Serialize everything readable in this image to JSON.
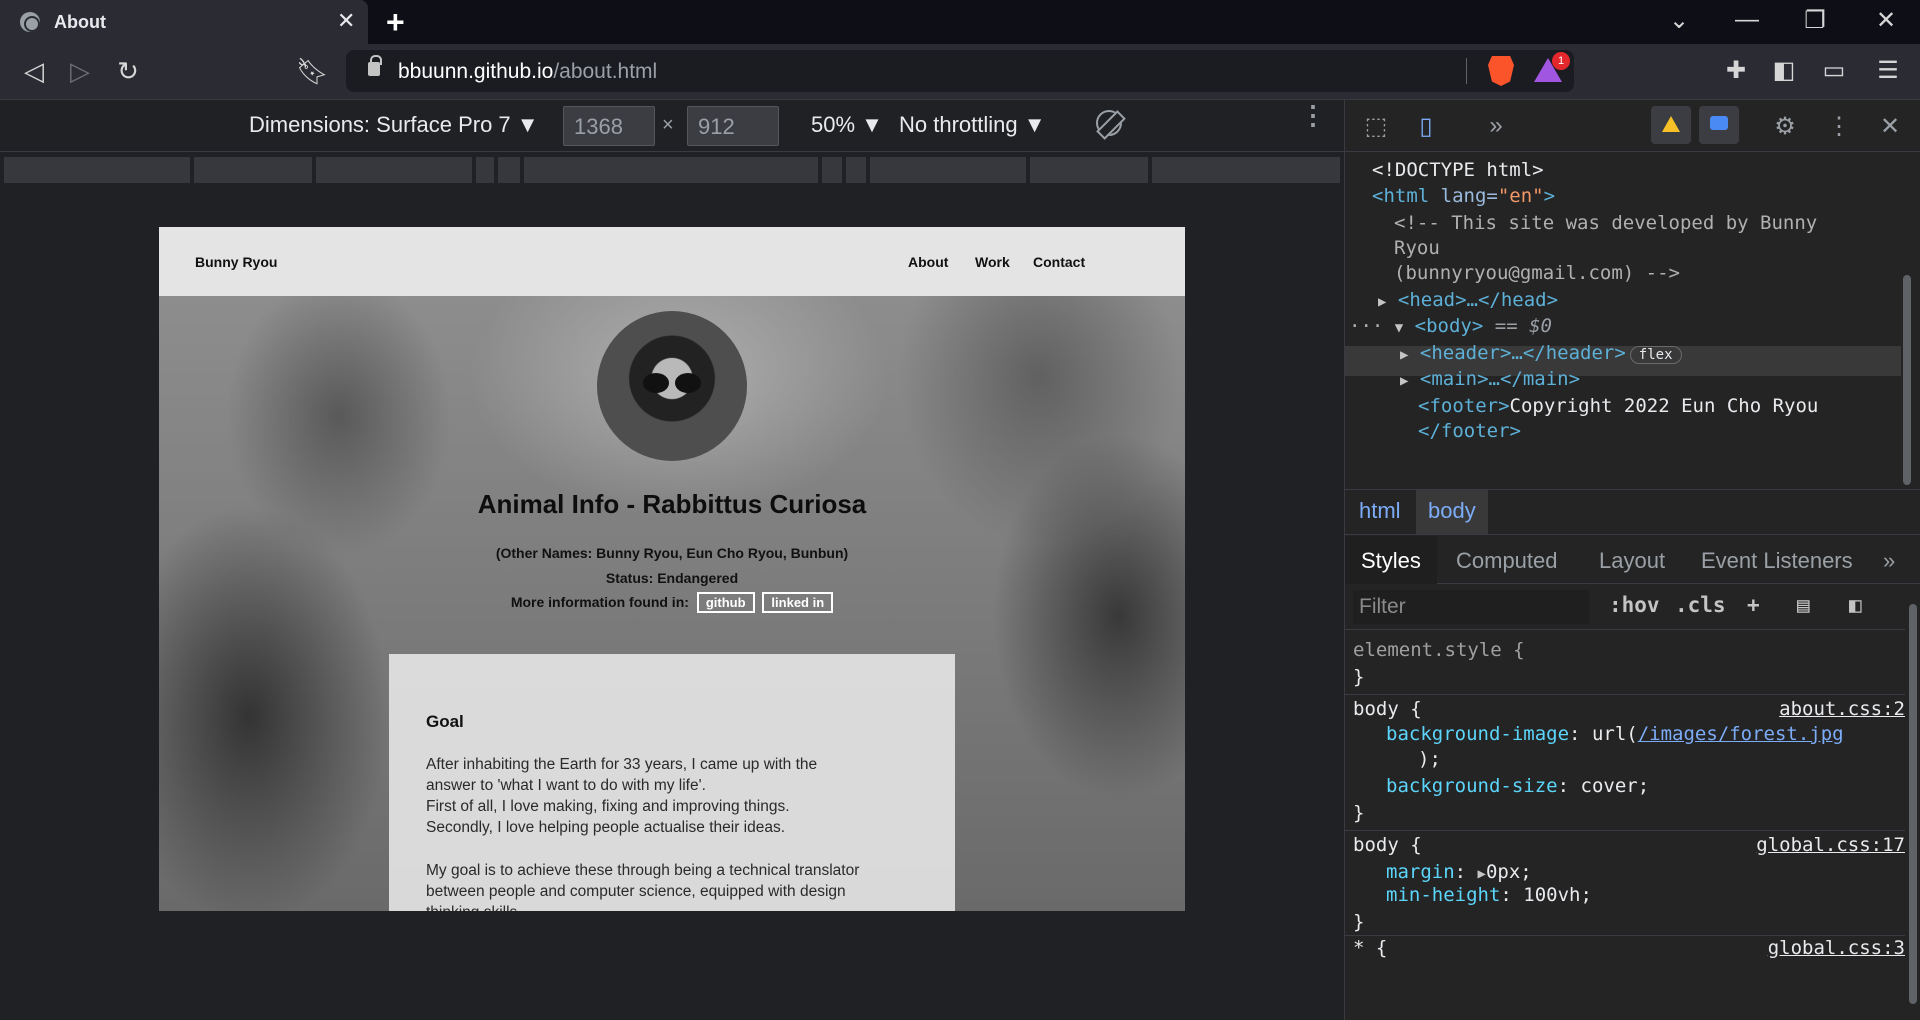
{
  "browser": {
    "tab_title": "About",
    "close_glyph": "✕",
    "new_tab_glyph": "+",
    "window_controls": [
      "⌄",
      "—",
      "❐",
      "✕"
    ],
    "url_host": "bbuunn.github.io",
    "url_path": "/about.html",
    "rewards_badge": "1",
    "icons": [
      "back-icon",
      "forward-icon",
      "reload-icon",
      "bookmark-icon",
      "lock-icon",
      "brave-shields-icon",
      "brave-rewards-icon",
      "extensions-icon",
      "sidebar-icon",
      "wallet-icon",
      "menu-icon"
    ]
  },
  "device_toolbar": {
    "dimensions_label": "Dimensions: Surface Pro 7 ▼",
    "width": "1368",
    "height": "912",
    "times": "×",
    "zoom": "50% ▼",
    "throttling": "No throttling ▼"
  },
  "site": {
    "logo": "Bunny Ryou",
    "nav": [
      "About",
      "Work",
      "Contact"
    ],
    "heading": "Animal Info - Rabbittus Curiosa",
    "other_names": "(Other Names: Bunny Ryou, Eun Cho Ryou, Bunbun)",
    "status": "Status: Endangered",
    "more_info": "More information found in:",
    "links": [
      "github",
      "linked in"
    ],
    "card": {
      "title": "Goal",
      "para1": [
        "After inhabiting the Earth for 33 years, I came up with the",
        "answer to 'what I want to do with my life'.",
        "First of all, I love making, fixing and improving things.",
        "Secondly, I love helping people actualise their ideas."
      ],
      "para2": [
        "My goal is to achieve these through being a technical translator",
        "between people and computer science, equipped with design",
        "thinking skills."
      ]
    }
  },
  "devtools": {
    "dom": {
      "doctype": "<!DOCTYPE html>",
      "html_open": "<html",
      "lang_attr": "lang=",
      "lang_val": "\"en\"",
      "comment1": "<!-- This site was developed by Bunny",
      "comment2": "Ryou",
      "comment3": "(bunnyryou@gmail.com) -->",
      "head": "<head>…</head>",
      "body": "<body>",
      "body_eq": "== $0",
      "header": "<header>…</header>",
      "flex_badge": "flex",
      "main": "<main>…</main>",
      "footer_open": "<footer>",
      "footer_text": "Copyright 2022 Eun Cho Ryou",
      "footer_close": "</footer>",
      "tri_closed": "▶",
      "tri_open": "▼",
      "dots": "···"
    },
    "breadcrumbs": [
      "html",
      "body"
    ],
    "tabs": [
      "Styles",
      "Computed",
      "Layout",
      "Event Listeners"
    ],
    "more_tabs": "»",
    "filter_placeholder": "Filter",
    "filter_buttons": [
      ":hov",
      ".cls",
      "+"
    ],
    "styles": {
      "element_style": "element.style {",
      "close_brace": "}",
      "rule1_selector": "body {",
      "rule1_source": "about.css:2",
      "rule1_prop1": "background-image",
      "rule1_val1_prefix": "url(",
      "rule1_val1_link": "/images/forest.jpg",
      "rule1_val1_suffix": ");",
      "rule1_prop2": "background-size",
      "rule1_val2": "cover;",
      "rule2_selector": "body {",
      "rule2_source": "global.css:17",
      "rule2_prop1": "margin",
      "rule2_val1": "0px;",
      "rule2_prop2": "min-height",
      "rule2_val2": "100vh;",
      "rule3_selector": "* {",
      "rule3_source": "global.css:3",
      "colon": ":"
    }
  }
}
